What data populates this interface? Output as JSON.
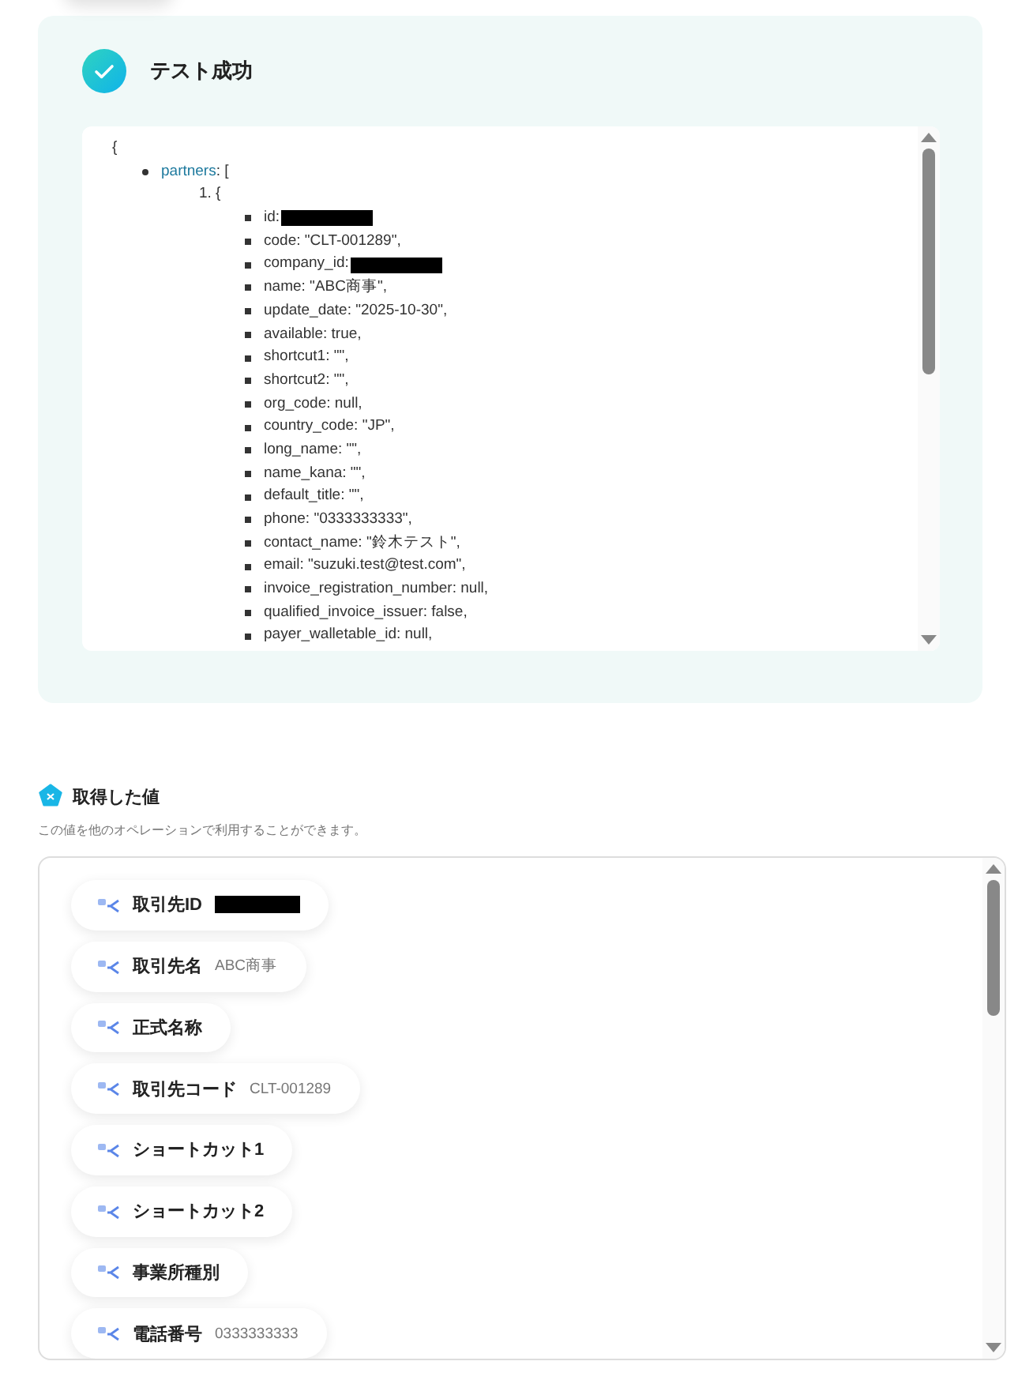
{
  "test_result": {
    "title": "テスト成功",
    "json_view": {
      "open": "{",
      "items": [
        {
          "key": "partners",
          "open": ": [",
          "children": [
            {
              "marker": "1.",
              "open": "{",
              "fields": [
                {
                  "text": "id:",
                  "redacted": true
                },
                {
                  "text": "code: \"CLT-001289\","
                },
                {
                  "text": "company_id:",
                  "redacted": true
                },
                {
                  "text": "name: \"ABC商事\","
                },
                {
                  "text": "update_date: \"2025-10-30\","
                },
                {
                  "text": "available: true,"
                },
                {
                  "text": "shortcut1: \"\","
                },
                {
                  "text": "shortcut2: \"\","
                },
                {
                  "text": "org_code: null,"
                },
                {
                  "text": "country_code: \"JP\","
                },
                {
                  "text": "long_name: \"\","
                },
                {
                  "text": "name_kana: \"\","
                },
                {
                  "text": "default_title: \"\","
                },
                {
                  "text": "phone: \"0333333333\","
                },
                {
                  "text": "contact_name: \"鈴木テスト\","
                },
                {
                  "text": "email: \"suzuki.test@test.com\","
                },
                {
                  "text": "invoice_registration_number: null,"
                },
                {
                  "text": "qualified_invoice_issuer: false,"
                },
                {
                  "text": "payer_walletable_id: null,"
                }
              ]
            }
          ]
        }
      ]
    }
  },
  "acquired_values": {
    "title": "取得した値",
    "description": "この値を他のオペレーションで利用することができます。",
    "items": [
      {
        "label": "取引先ID",
        "redacted": true
      },
      {
        "label": "取引先名",
        "value": "ABC商事"
      },
      {
        "label": "正式名称"
      },
      {
        "label": "取引先コード",
        "value": "CLT-001289"
      },
      {
        "label": "ショートカット1"
      },
      {
        "label": "ショートカット2"
      },
      {
        "label": "事業所種別"
      },
      {
        "label": "電話番号",
        "value": "0333333333"
      }
    ]
  }
}
